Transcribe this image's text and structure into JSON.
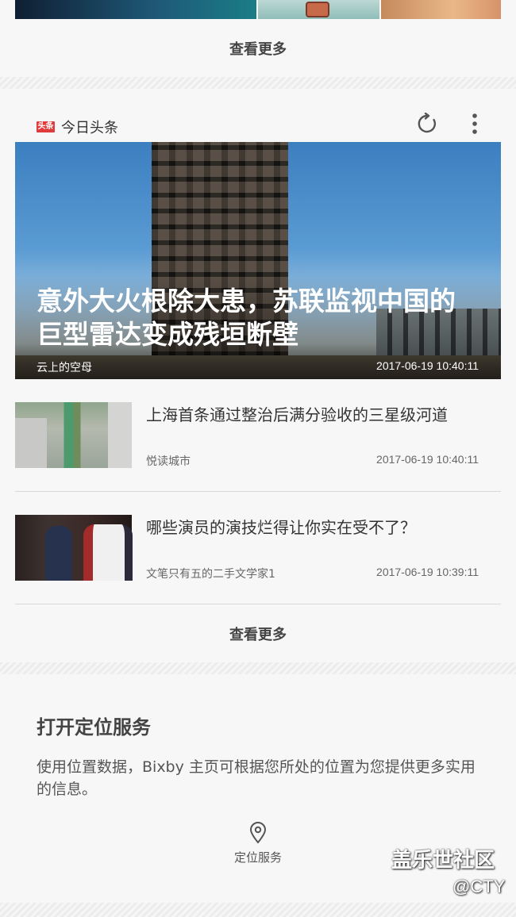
{
  "top_card": {
    "more_label": "查看更多"
  },
  "news_card": {
    "brand_logo_text": "头条",
    "brand_name": "今日头条",
    "accent_color": "#e03b3b",
    "icons": {
      "refresh": "refresh-icon",
      "more": "more-vert-icon"
    },
    "hero": {
      "title": "意外大火根除大患，苏联监视中国的巨型雷达变成残垣断壁",
      "source": "云上的空母",
      "time": "2017-06-19 10:40:11"
    },
    "items": [
      {
        "title": "上海首条通过整治后满分验收的三星级河道",
        "source": "悦读城市",
        "time": "2017-06-19 10:40:11"
      },
      {
        "title": "哪些演员的演技烂得让你实在受不了？",
        "source": "文笔只有五的二手文学家1",
        "time": "2017-06-19 10:39:11"
      }
    ],
    "more_label": "查看更多"
  },
  "location_card": {
    "title": "打开定位服务",
    "description": "使用位置数据，Bixby 主页可根据您所处的位置为您提供更多实用的信息。",
    "action_label": "定位服务",
    "action_icon": "location-pin-icon"
  },
  "watermark": {
    "line1": "盖乐世社区",
    "line2": "@CTY"
  }
}
